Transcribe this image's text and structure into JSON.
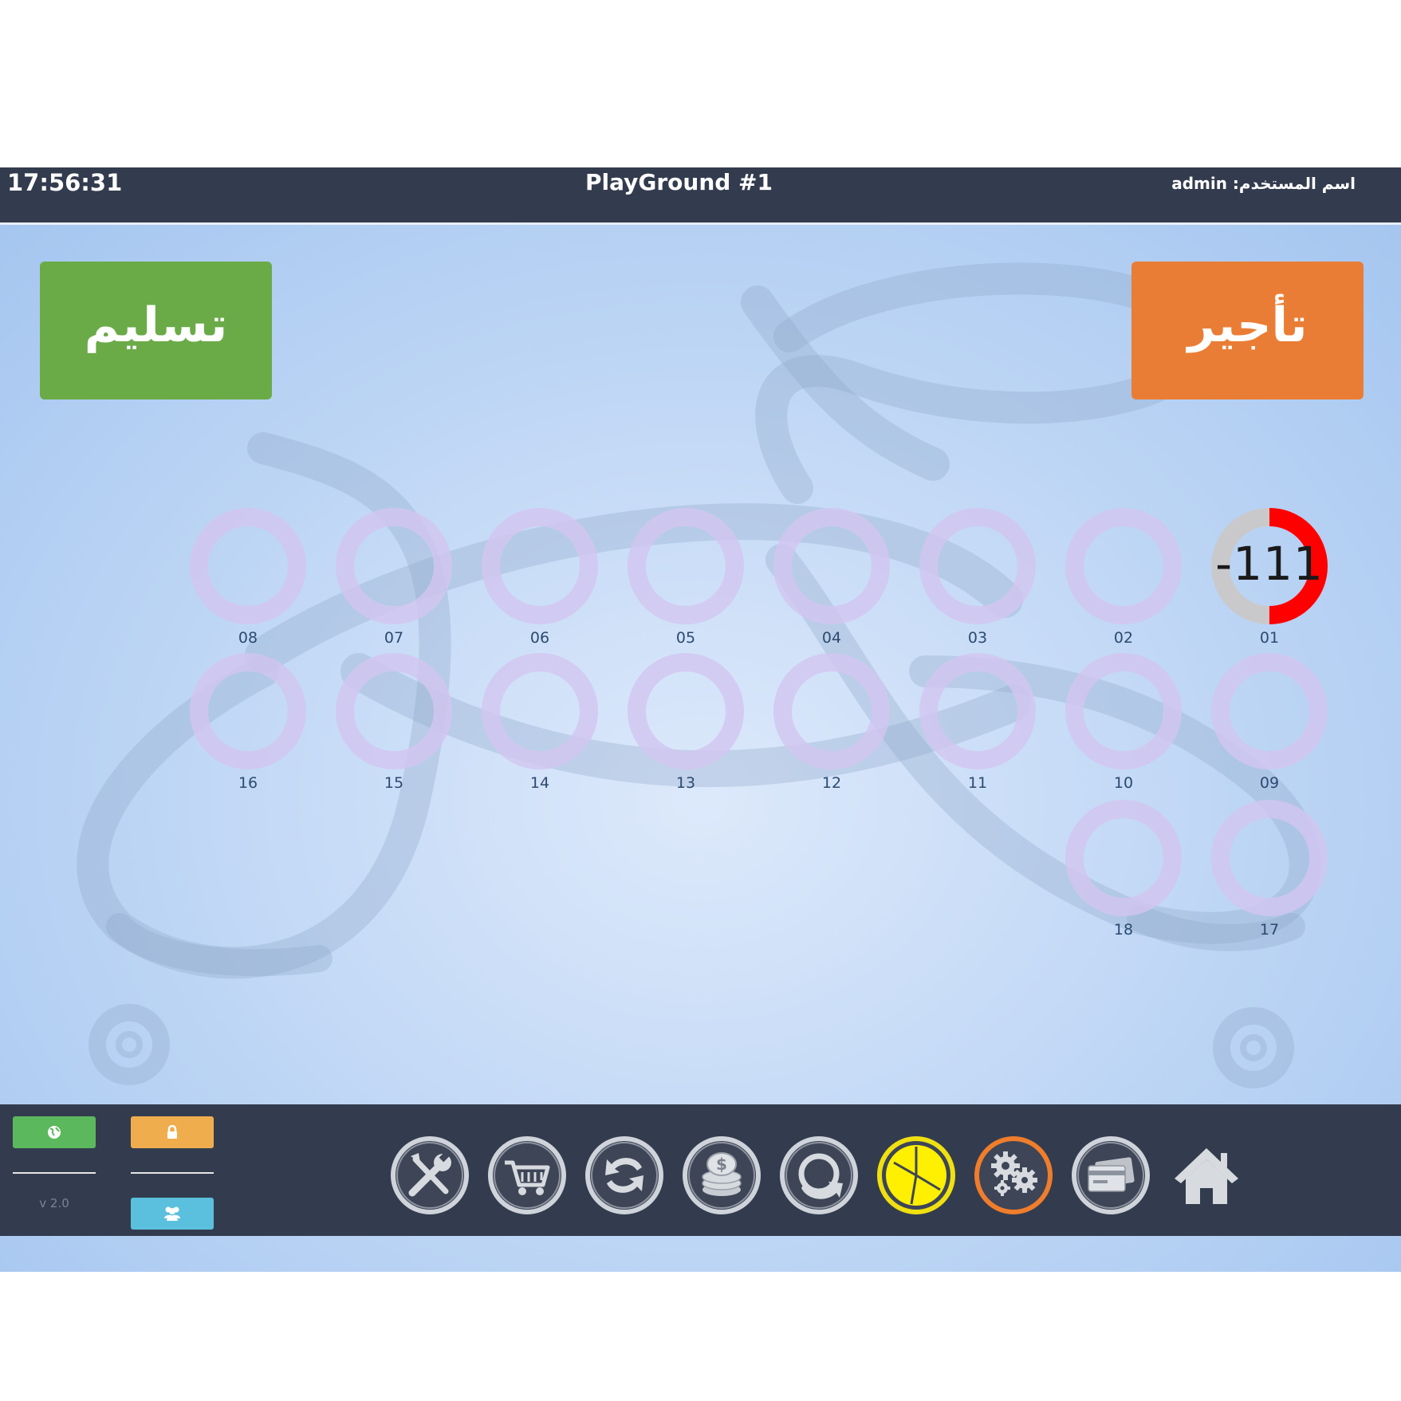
{
  "header": {
    "clock": "17:56:31",
    "title": "PlayGround #1",
    "user_label": "اسم المستخدم: admin"
  },
  "actions": {
    "deliver_label": "تسليم",
    "rent_label": "تأجير",
    "deliver_color": "#6aab48",
    "rent_color": "#ea7d35"
  },
  "slots": [
    {
      "number": "01",
      "active": true,
      "counter": "111-",
      "progress": 0.5
    },
    {
      "number": "02",
      "active": false
    },
    {
      "number": "03",
      "active": false
    },
    {
      "number": "04",
      "active": false
    },
    {
      "number": "05",
      "active": false
    },
    {
      "number": "06",
      "active": false
    },
    {
      "number": "07",
      "active": false
    },
    {
      "number": "08",
      "active": false
    },
    {
      "number": "09",
      "active": false
    },
    {
      "number": "10",
      "active": false
    },
    {
      "number": "11",
      "active": false
    },
    {
      "number": "12",
      "active": false
    },
    {
      "number": "13",
      "active": false
    },
    {
      "number": "14",
      "active": false
    },
    {
      "number": "15",
      "active": false
    },
    {
      "number": "16",
      "active": false
    },
    {
      "number": "17",
      "active": false
    },
    {
      "number": "18",
      "active": false
    }
  ],
  "footer": {
    "version": "v 2.0",
    "small_buttons": [
      {
        "icon": "globe-icon",
        "color": "#5cb85c"
      },
      {
        "icon": "lock-icon",
        "color": "#f0ad4e"
      },
      {
        "icon": "users-icon",
        "color": "#5bc0de"
      }
    ],
    "toolbar": [
      {
        "icon": "tools-icon",
        "ring": "silver"
      },
      {
        "icon": "cart-icon",
        "ring": "silver"
      },
      {
        "icon": "exchange-icon",
        "ring": "silver"
      },
      {
        "icon": "coins-icon",
        "ring": "silver"
      },
      {
        "icon": "redo-icon",
        "ring": "silver"
      },
      {
        "icon": "pie-chart-icon",
        "ring": "yellow"
      },
      {
        "icon": "gears-icon",
        "ring": "orange"
      },
      {
        "icon": "credit-cards-icon",
        "ring": "silver"
      },
      {
        "icon": "home-icon",
        "ring": "none"
      }
    ]
  }
}
